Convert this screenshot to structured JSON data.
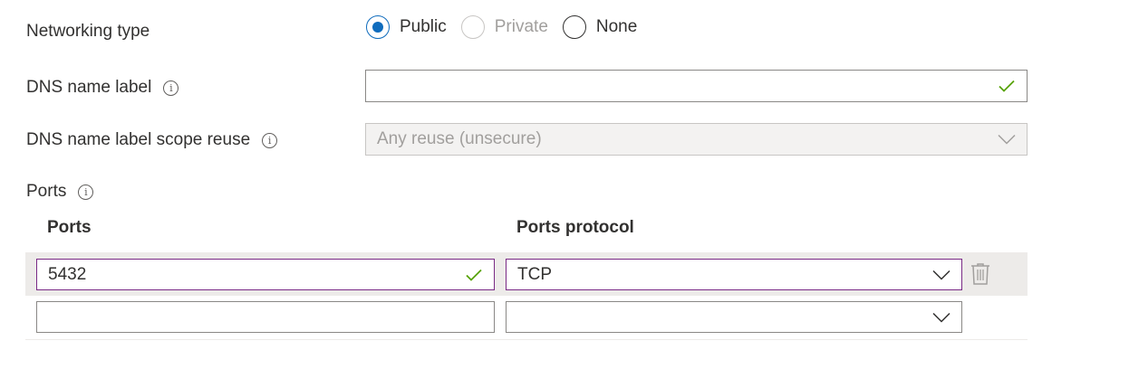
{
  "networking": {
    "label": "Networking type",
    "options": [
      {
        "label": "Public",
        "state": "checked"
      },
      {
        "label": "Private",
        "state": "disabled"
      },
      {
        "label": "None",
        "state": "unchecked"
      }
    ]
  },
  "dns_label": {
    "label": "DNS name label",
    "value": "",
    "valid": true
  },
  "dns_scope": {
    "label": "DNS name label scope reuse",
    "value": "Any reuse (unsecure)",
    "disabled": true
  },
  "ports": {
    "section_label": "Ports",
    "col_ports": "Ports",
    "col_protocol": "Ports protocol",
    "rows": [
      {
        "port": "5432",
        "protocol": "TCP"
      },
      {
        "port": "",
        "protocol": ""
      }
    ]
  },
  "colors": {
    "accent": "#0f6cbd",
    "focus_border": "#7a2a86",
    "valid_check": "#57a300",
    "row_highlight": "#edebe9"
  },
  "icons": [
    "info-icon",
    "check-icon",
    "chevron-down-icon",
    "trash-icon"
  ]
}
